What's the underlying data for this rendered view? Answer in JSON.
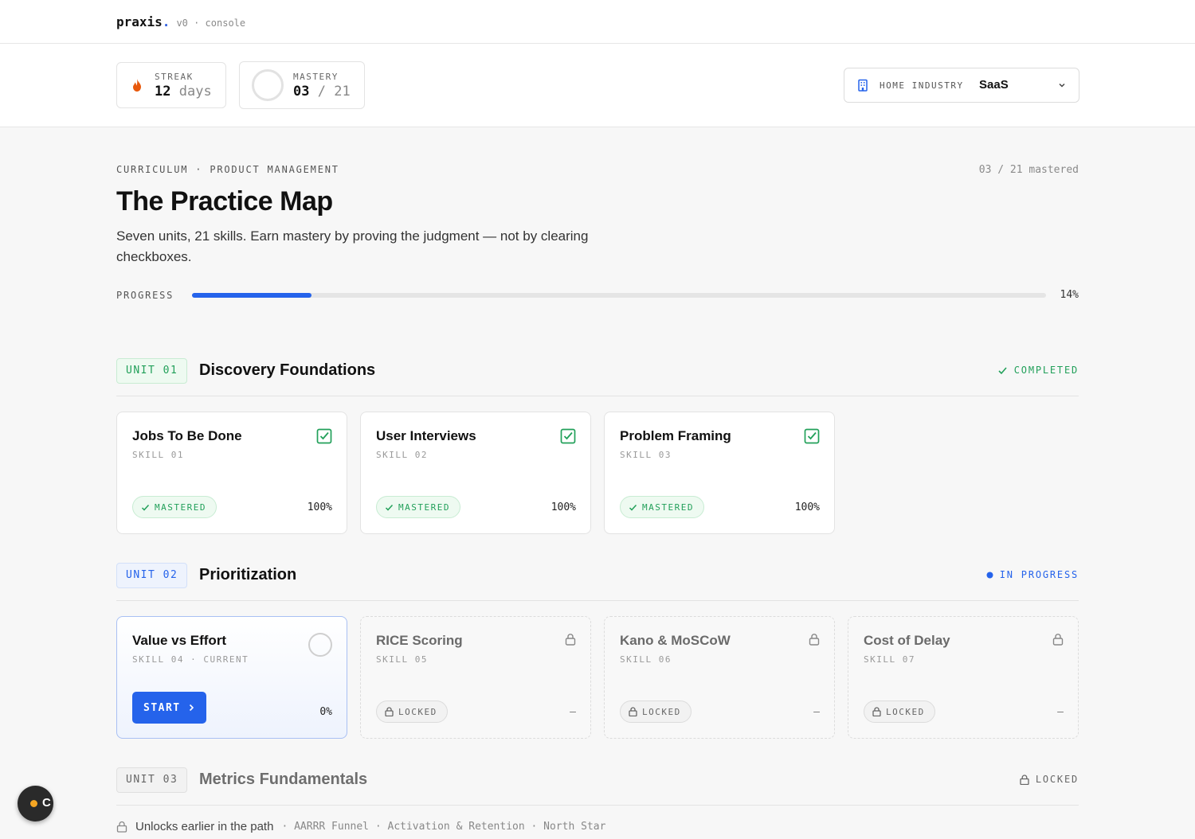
{
  "app": {
    "brand": "praxis",
    "brand_dot": ".",
    "meta": "v0 · console"
  },
  "stats": {
    "streak": {
      "label": "STREAK",
      "value": "12",
      "unit": "days"
    },
    "mastery": {
      "label": "MASTERY",
      "value": "03",
      "sep": "/",
      "total": "21"
    }
  },
  "industry": {
    "label": "HOME INDUSTRY",
    "value": "SaaS"
  },
  "header": {
    "eyebrow": "CURRICULUM · PRODUCT MANAGEMENT",
    "mastered_count": "03 / 21 mastered",
    "title": "The Practice Map",
    "subtitle": "Seven units, 21 skills. Earn mastery by proving the judgment — not by clearing checkboxes."
  },
  "progress": {
    "label": "PROGRESS",
    "value": 0.14,
    "text": "14%"
  },
  "units": [
    {
      "tag": "UNIT 01",
      "title": "Discovery Foundations",
      "status": "COMPLETED",
      "skills": [
        {
          "title": "Jobs To Be Done",
          "sub": "SKILL 01",
          "badge": "MASTERED",
          "pct": "100%"
        },
        {
          "title": "User Interviews",
          "sub": "SKILL 02",
          "badge": "MASTERED",
          "pct": "100%"
        },
        {
          "title": "Problem Framing",
          "sub": "SKILL 03",
          "badge": "MASTERED",
          "pct": "100%"
        }
      ]
    },
    {
      "tag": "UNIT 02",
      "title": "Prioritization",
      "status": "IN PROGRESS",
      "skills": [
        {
          "title": "Value vs Effort",
          "sub": "SKILL 04 · CURRENT",
          "button": "START",
          "pct": "0%"
        },
        {
          "title": "RICE Scoring",
          "sub": "SKILL 05",
          "badge": "LOCKED",
          "pct": "–"
        },
        {
          "title": "Kano & MoSCoW",
          "sub": "SKILL 06",
          "badge": "LOCKED",
          "pct": "–"
        },
        {
          "title": "Cost of Delay",
          "sub": "SKILL 07",
          "badge": "LOCKED",
          "pct": "–"
        }
      ]
    },
    {
      "tag": "UNIT 03",
      "title": "Metrics Fundamentals",
      "status": "LOCKED",
      "unlock_text": "Unlocks earlier in the path",
      "unlock_items": "· AARRR Funnel · Activation & Retention · North Star"
    }
  ],
  "fab": {
    "letter": "C"
  },
  "colors": {
    "accent": "#2563eb",
    "success": "#22a05a",
    "flame": "#e8590c",
    "fab_dot": "#f5a623"
  }
}
